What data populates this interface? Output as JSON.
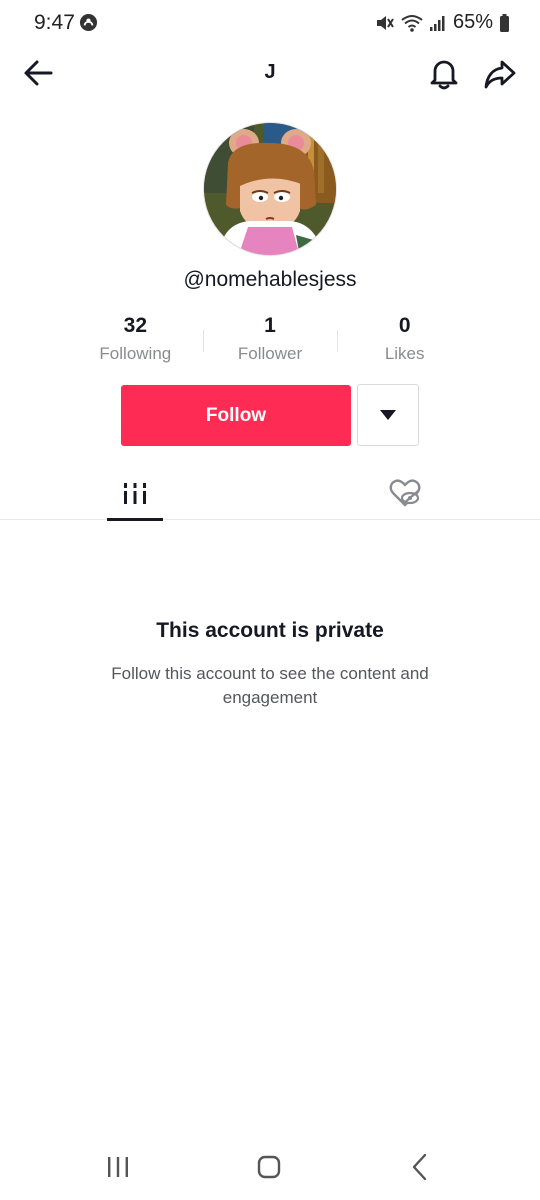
{
  "status_bar": {
    "time": "9:47",
    "battery": "65%"
  },
  "header": {
    "title": "J"
  },
  "profile": {
    "username": "@nomehablesjess"
  },
  "stats": [
    {
      "value": "32",
      "label": "Following"
    },
    {
      "value": "1",
      "label": "Follower"
    },
    {
      "value": "0",
      "label": "Likes"
    }
  ],
  "actions": {
    "follow_label": "Follow"
  },
  "tabs": {
    "videos_icon": "grid-icon",
    "liked_icon": "hidden-liked-icon"
  },
  "private": {
    "title": "This account is private",
    "description": "Follow this account to see the content and engagement"
  },
  "colors": {
    "accent": "#fe2c55",
    "text_primary": "#161823",
    "text_secondary": "#8a8b91"
  }
}
